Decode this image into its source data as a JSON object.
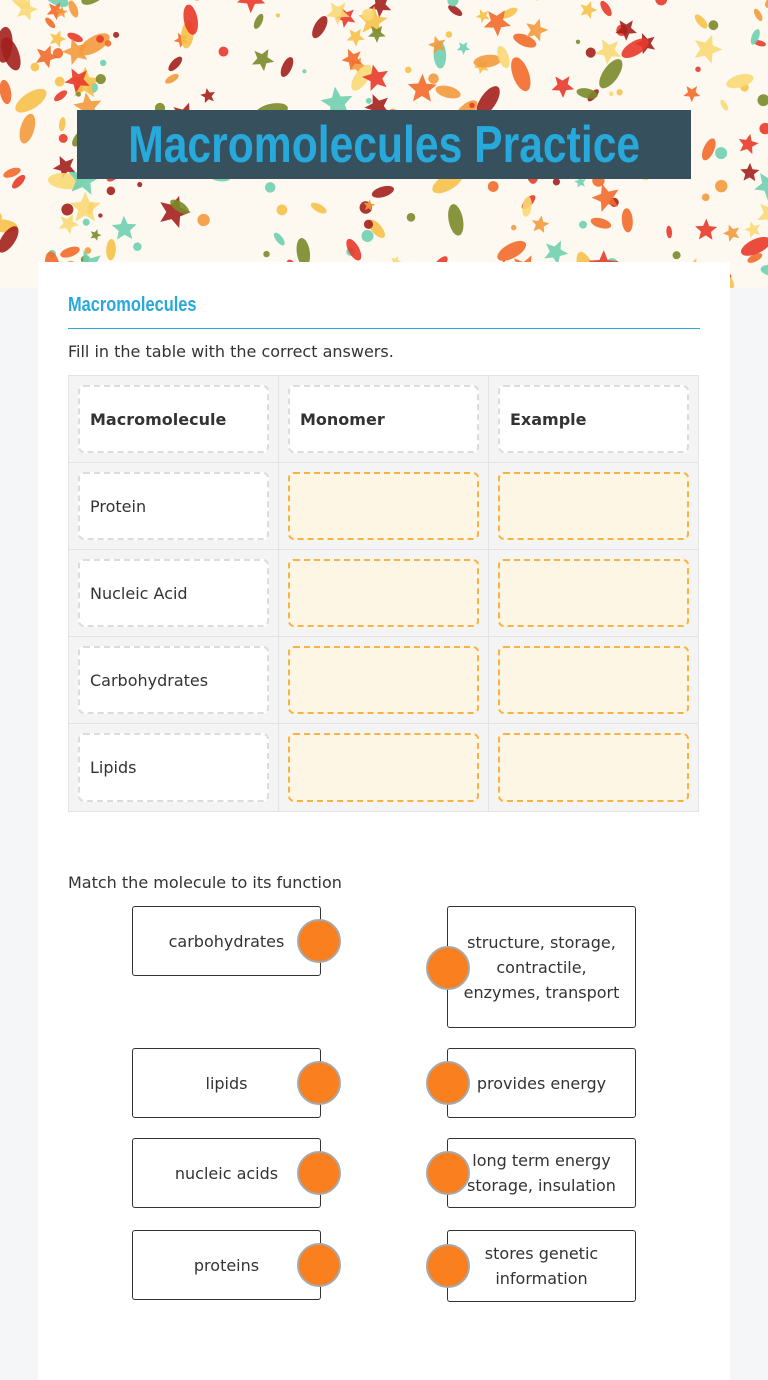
{
  "banner": {
    "title": "Macromolecules Practice",
    "colors": {
      "title_bg": "#36505e",
      "title_text": "#27a9dc"
    }
  },
  "section": {
    "title": "Macromolecules",
    "instruction": "Fill in the table with the correct answers."
  },
  "table": {
    "headers": [
      "Macromolecule",
      "Monomer",
      "Example"
    ],
    "rows": [
      {
        "macromolecule": "Protein",
        "monomer": "",
        "example": ""
      },
      {
        "macromolecule": "Nucleic Acid",
        "monomer": "",
        "example": ""
      },
      {
        "macromolecule": "Carbohydrates",
        "monomer": "",
        "example": ""
      },
      {
        "macromolecule": "Lipids",
        "monomer": "",
        "example": ""
      }
    ]
  },
  "matching": {
    "instruction": "Match the molecule to its function",
    "left": [
      "carbohydrates",
      "lipids",
      "nucleic acids",
      "proteins"
    ],
    "right": [
      "structure, storage, contractile, enzymes, transport",
      "provides energy",
      "long term energy storage, insulation",
      "stores genetic information"
    ],
    "colors": {
      "connector": "#fa7f1e"
    }
  }
}
